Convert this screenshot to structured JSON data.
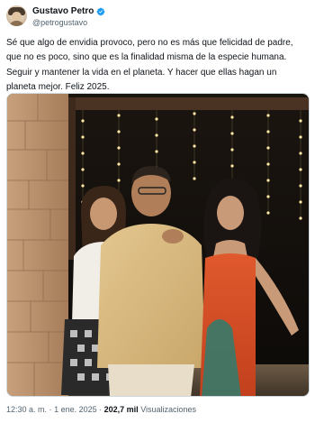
{
  "author": {
    "display_name": "Gustavo Petro",
    "handle": "@petrogustavo",
    "verified_icon": "verified-badge-icon",
    "verified_color": "#1d9bf0"
  },
  "post": {
    "lines": [
      "Sé que algo de envidia provoco, pero no es más que felicidad de padre,",
      "que no es poco, sino que es la finalidad misma de la especie humana.",
      "Seguir y mantener la vida en el planeta. Y hacer que ellas hagan un",
      "planeta mejor. Feliz 2025."
    ]
  },
  "media": {
    "type": "photo"
  },
  "meta": {
    "time": "12:30 a. m.",
    "separator": "·",
    "date": "1 ene. 2025",
    "views_count": "202,7 mil",
    "views_label": "Visualizaciones"
  }
}
